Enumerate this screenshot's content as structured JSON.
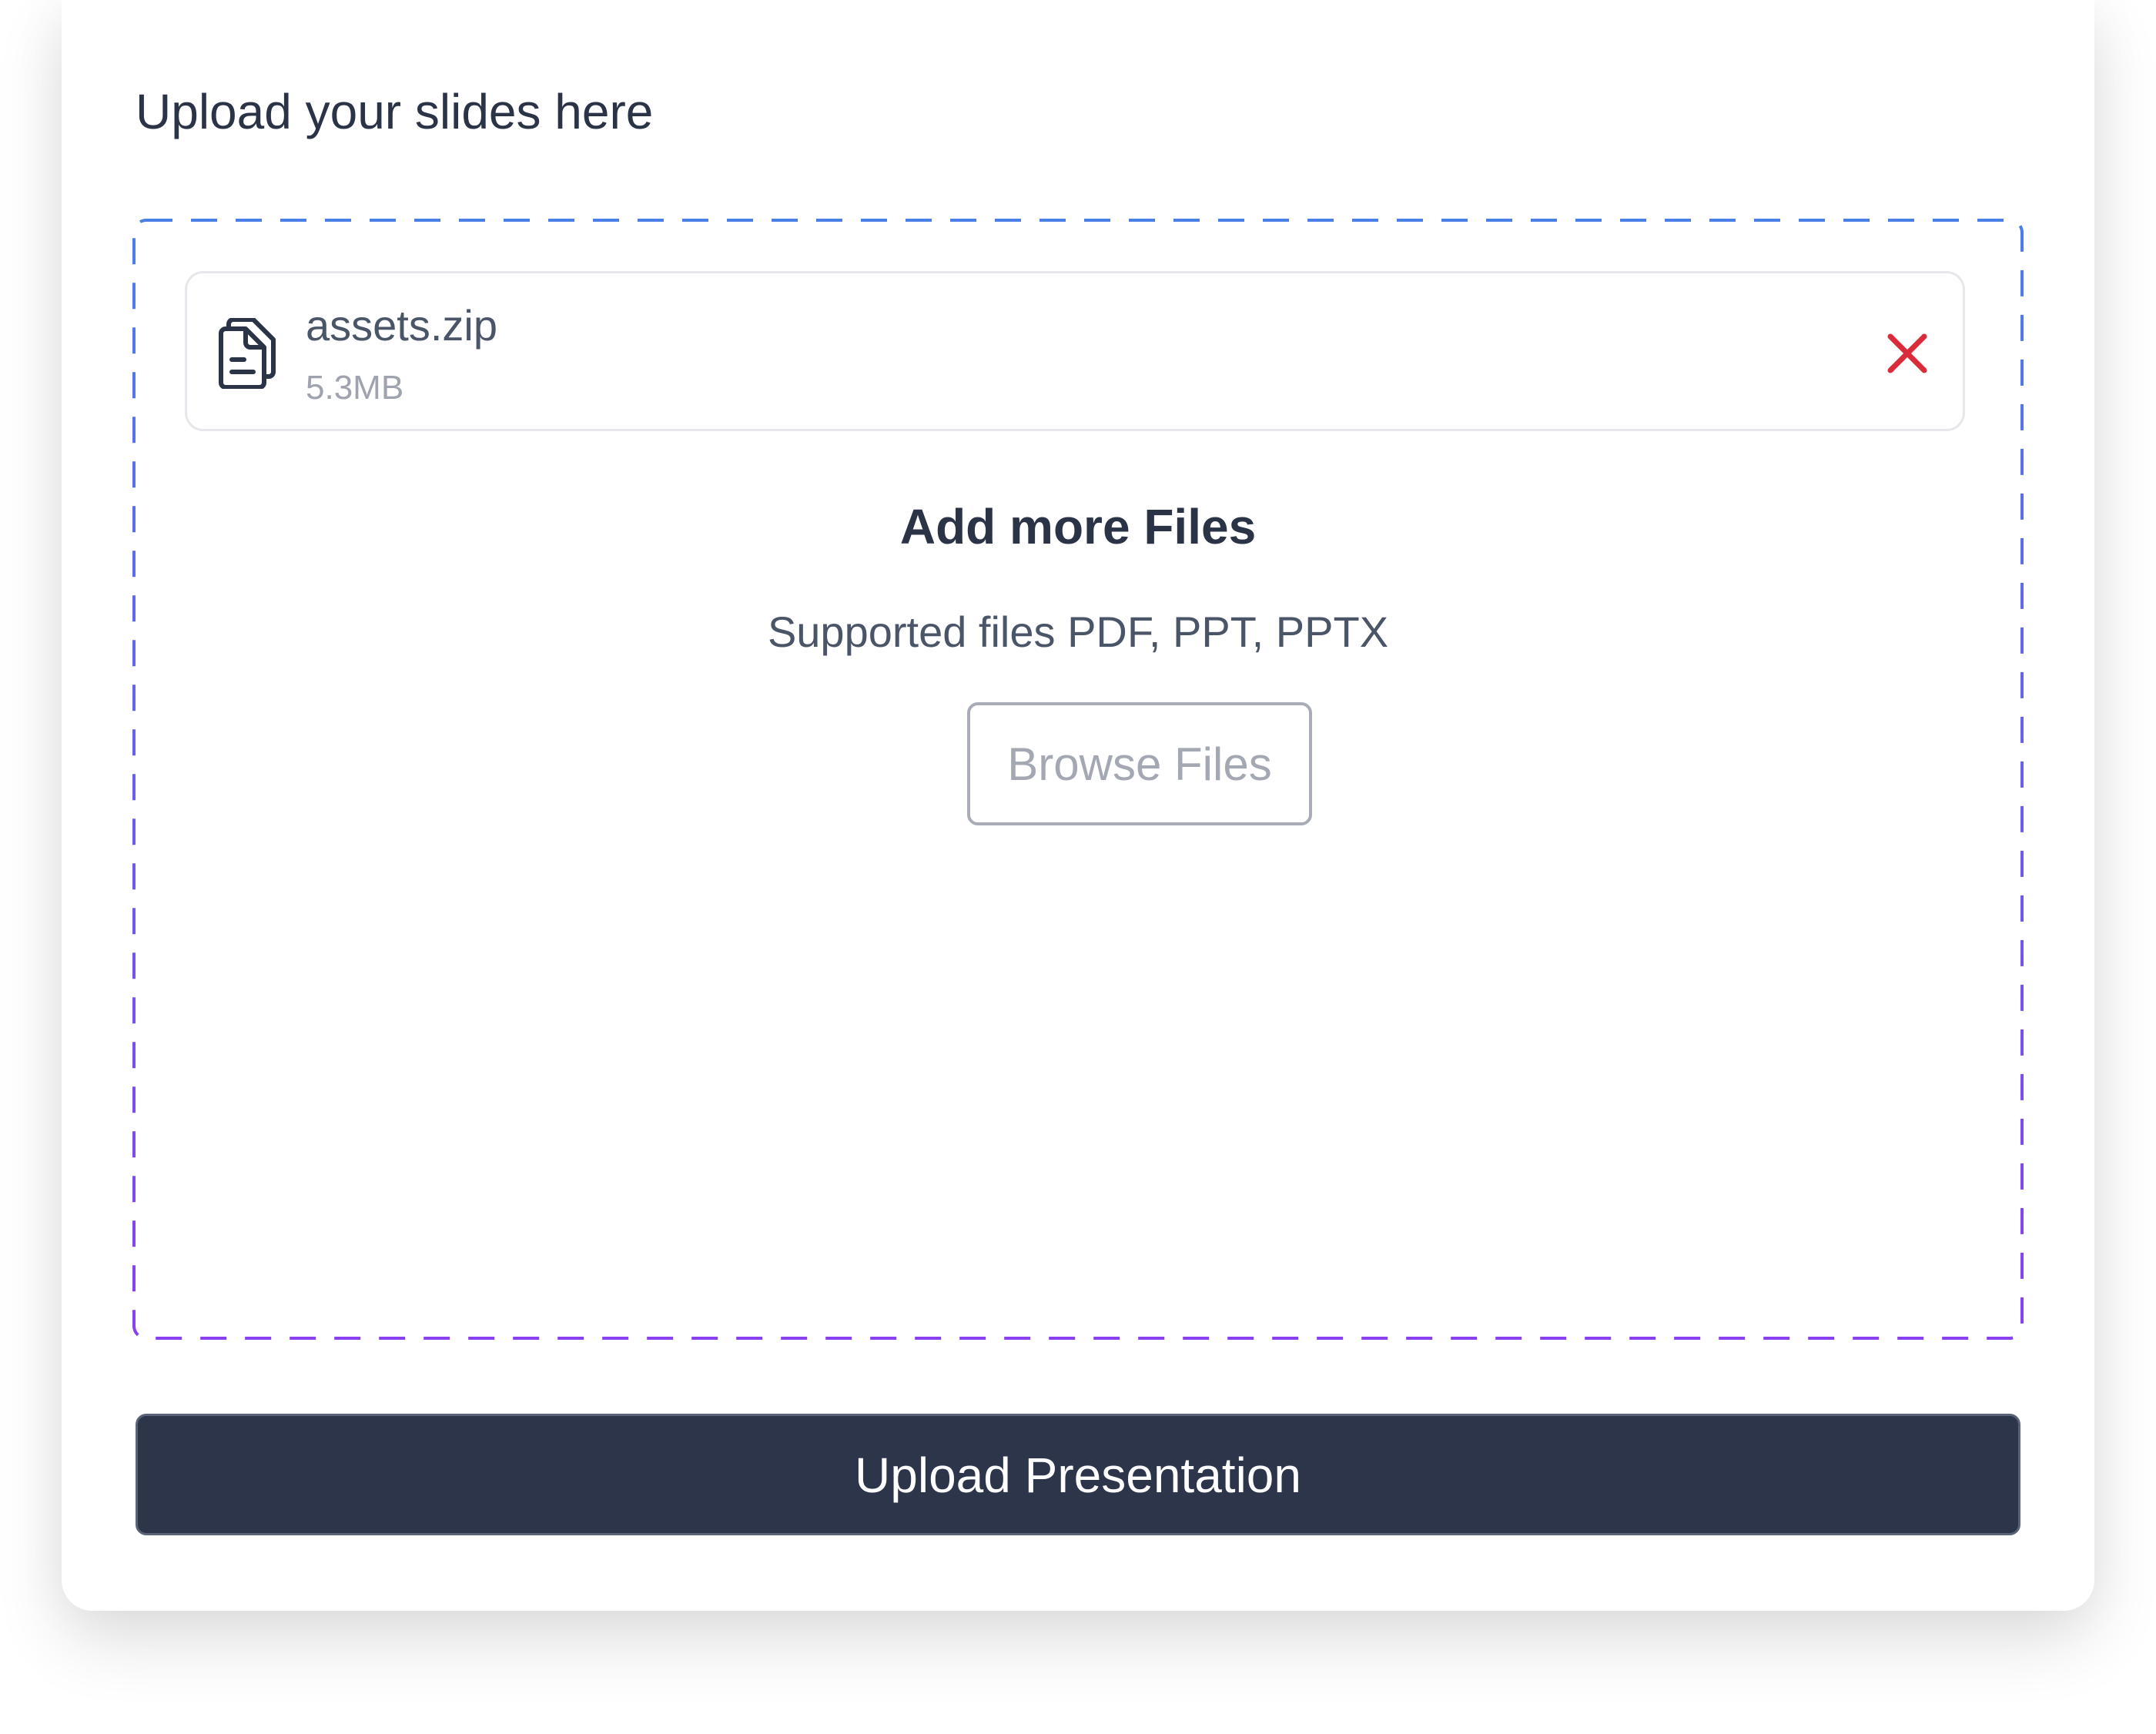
{
  "upload_panel": {
    "title": "Upload your slides here",
    "dropzone": {
      "border_gradient": [
        "#4a7fe8",
        "#8a3ff0"
      ],
      "files": [
        {
          "name": "assets.zip",
          "size": "5.3MB",
          "icon": "file-document-icon",
          "remove_icon": "close-icon",
          "remove_color": "#d92b3a"
        }
      ],
      "add_more_title": "Add more Files",
      "supported_text": "Supported files PDF, PPT, PPTX",
      "browse_label": "Browse Files"
    },
    "submit_label": "Upload Presentation",
    "submit_color": "#2d354b"
  }
}
